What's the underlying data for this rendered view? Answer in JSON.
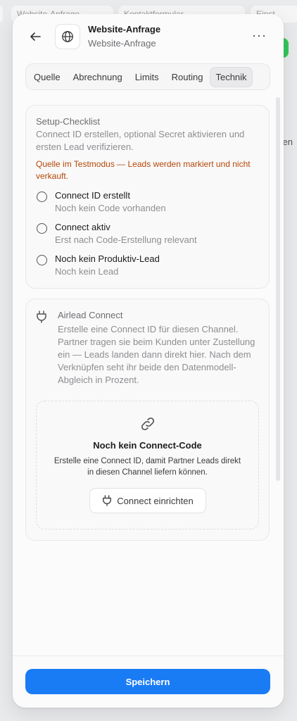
{
  "background": {
    "tabs": [
      "Website-Anfrage",
      "Kontaktformular",
      "Einst"
    ],
    "right_text": "en"
  },
  "header": {
    "title": "Website-Anfrage",
    "subtitle": "Website-Anfrage",
    "more_label": "···"
  },
  "tabs": [
    {
      "label": "Quelle",
      "active": false
    },
    {
      "label": "Abrechnung",
      "active": false
    },
    {
      "label": "Limits",
      "active": false
    },
    {
      "label": "Routing",
      "active": false
    },
    {
      "label": "Technik",
      "active": true
    }
  ],
  "checklist": {
    "title": "Setup-Checklist",
    "description": "Connect ID erstellen, optional Secret aktivieren und ersten Lead verifizieren.",
    "warning": "Quelle im Testmodus — Leads werden markiert und nicht verkauft.",
    "items": [
      {
        "label": "Connect ID erstellt",
        "sub": "Noch kein Code vorhanden",
        "done": false
      },
      {
        "label": "Connect aktiv",
        "sub": "Erst nach Code-Erstellung relevant",
        "done": false
      },
      {
        "label": "Noch kein Produktiv-Lead",
        "sub": "Noch kein Lead",
        "done": false
      }
    ]
  },
  "connect": {
    "title": "Airlead Connect",
    "description": "Erstelle eine Connect ID für diesen Channel. Partner tragen sie beim Kunden unter Zustellung ein — Leads landen dann direkt hier. Nach dem Verknüpfen seht ihr beide den Datenmodell-Abgleich in Prozent.",
    "empty_title": "Noch kein Connect-Code",
    "empty_description": "Erstelle eine Connect ID, damit Partner Leads direkt in diesen Channel liefern können.",
    "button_label": "Connect einrichten"
  },
  "footer": {
    "save_label": "Speichern"
  },
  "colors": {
    "primary": "#1a7cf5",
    "warning": "#b54708",
    "success": "#34c759"
  }
}
